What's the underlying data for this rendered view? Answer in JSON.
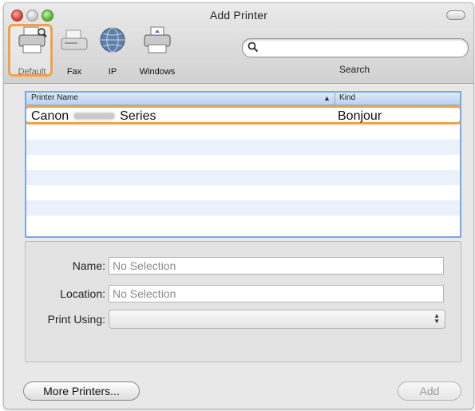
{
  "window": {
    "title": "Add Printer"
  },
  "toolbar": {
    "items": [
      {
        "label": "Default",
        "icon": "printer-icon"
      },
      {
        "label": "Fax",
        "icon": "fax-icon"
      },
      {
        "label": "IP",
        "icon": "globe-icon"
      },
      {
        "label": "Windows",
        "icon": "windows-printer-icon"
      }
    ],
    "search_label": "Search",
    "search_placeholder": ""
  },
  "printer_list": {
    "columns": [
      "Printer Name",
      "Kind"
    ],
    "rows": [
      {
        "name_prefix": "Canon",
        "name_suffix": "Series",
        "kind": "Bonjour"
      }
    ]
  },
  "details": {
    "name_label": "Name:",
    "name_value": "No Selection",
    "location_label": "Location:",
    "location_value": "No Selection",
    "print_using_label": "Print Using:",
    "print_using_value": ""
  },
  "buttons": {
    "more_printers": "More Printers...",
    "add": "Add"
  },
  "colors": {
    "highlight": "#f0a24a",
    "list_border": "#7aa8e6",
    "stripe": "#eaf1fb"
  }
}
